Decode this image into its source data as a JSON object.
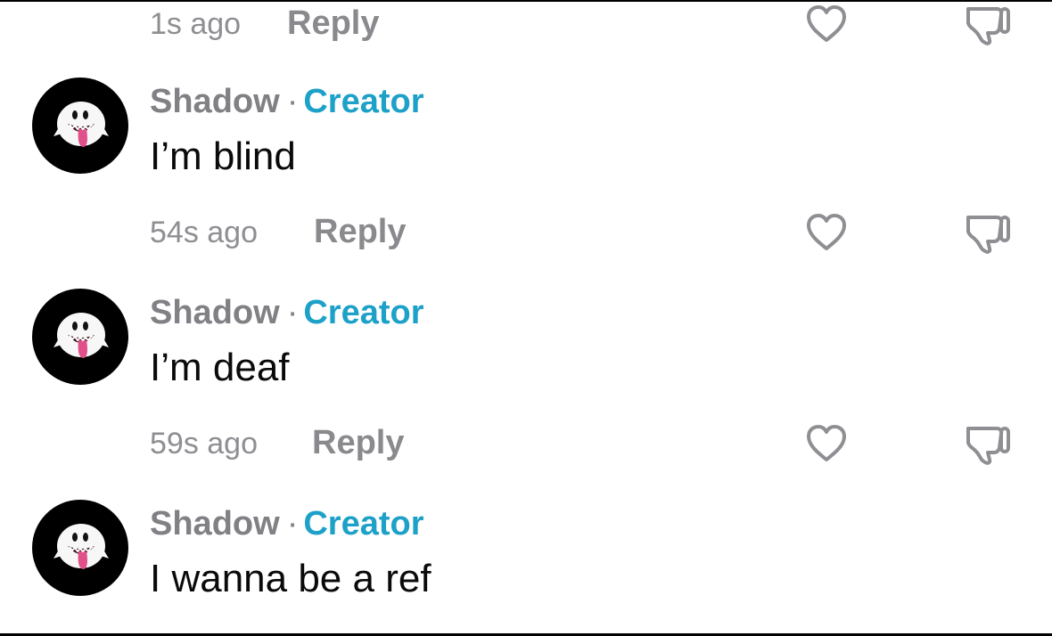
{
  "comments": [
    {
      "time": "1s ago",
      "reply_label": "Reply",
      "like_icon": "heart-icon",
      "dislike_icon": "thumbs-down-icon"
    },
    {
      "author": "Shadow",
      "separator": "·",
      "role": "Creator",
      "text": "I’m blind",
      "time": "54s ago",
      "reply_label": "Reply",
      "avatar_icon": "ghost-avatar",
      "like_icon": "heart-icon",
      "dislike_icon": "thumbs-down-icon"
    },
    {
      "author": "Shadow",
      "separator": "·",
      "role": "Creator",
      "text": "I’m deaf",
      "time": "59s ago",
      "reply_label": "Reply",
      "avatar_icon": "ghost-avatar",
      "like_icon": "heart-icon",
      "dislike_icon": "thumbs-down-icon"
    },
    {
      "author": "Shadow",
      "separator": "·",
      "role": "Creator",
      "text": "I wanna be a ref",
      "avatar_icon": "ghost-avatar"
    }
  ],
  "colors": {
    "creator_badge": "#1da1c8",
    "meta_text": "#8e8e93",
    "comment_text": "#0a0a0a",
    "avatar_bg": "#000000"
  }
}
